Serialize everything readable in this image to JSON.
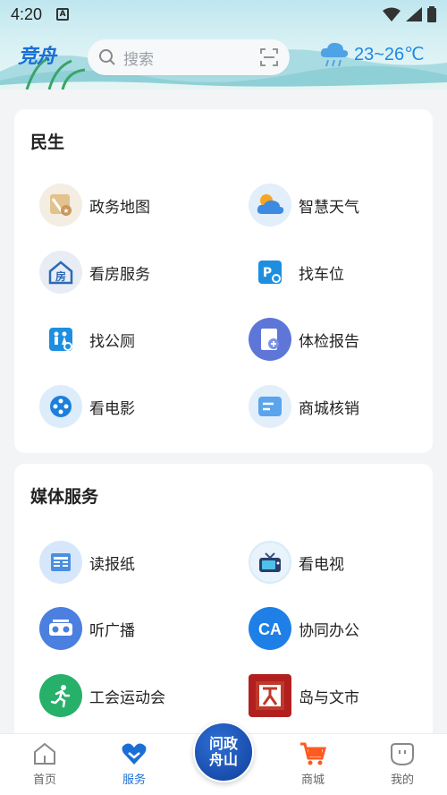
{
  "status": {
    "time": "4:20",
    "notif_icon_text": "A"
  },
  "header": {
    "logo": "竞舟",
    "search_placeholder": "搜索",
    "weather_text": "23~26℃"
  },
  "sections": [
    {
      "title": "民生",
      "items": [
        {
          "label": "政务地图",
          "icon": "map-icon"
        },
        {
          "label": "智慧天气",
          "icon": "weather-icon"
        },
        {
          "label": "看房服务",
          "icon": "house-icon"
        },
        {
          "label": "找车位",
          "icon": "parking-icon"
        },
        {
          "label": "找公厕",
          "icon": "toilet-icon"
        },
        {
          "label": "体检报告",
          "icon": "report-icon"
        },
        {
          "label": "看电影",
          "icon": "film-icon"
        },
        {
          "label": "商城核销",
          "icon": "voucher-icon"
        }
      ]
    },
    {
      "title": "媒体服务",
      "items": [
        {
          "label": "读报纸",
          "icon": "newspaper-icon"
        },
        {
          "label": "看电视",
          "icon": "tv-icon"
        },
        {
          "label": "听广播",
          "icon": "radio-icon"
        },
        {
          "label": "协同办公",
          "icon": "office-icon"
        },
        {
          "label": "工会运动会",
          "icon": "sports-icon"
        },
        {
          "label": "岛与文市",
          "icon": "culture-icon"
        }
      ]
    }
  ],
  "bottom_nav": {
    "home": "首页",
    "service": "服务",
    "center": "问政舟山",
    "center_line1": "问政",
    "center_line2": "舟山",
    "mall": "商城",
    "mine": "我的"
  },
  "colors": {
    "accent": "#1a6fd6",
    "mall": "#ff5a1f"
  }
}
